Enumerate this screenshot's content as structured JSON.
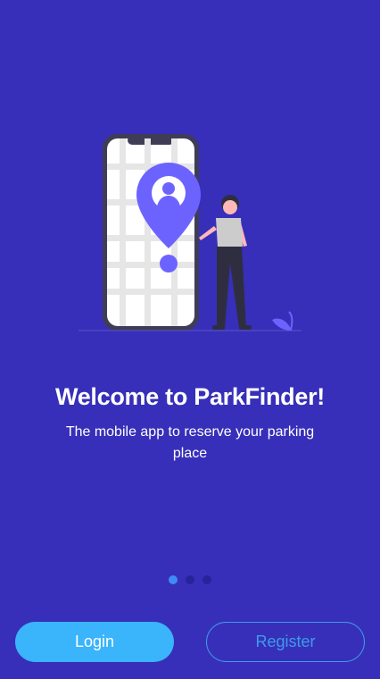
{
  "onboarding": {
    "title": "Welcome to ParkFinder!",
    "subtitle": "The mobile app to reserve your parking place",
    "pagination": {
      "total": 3,
      "active_index": 0
    },
    "illustration_icon": "phone-map-pin-person-illustration"
  },
  "actions": {
    "login_label": "Login",
    "register_label": "Register"
  },
  "colors": {
    "background": "#372fb9",
    "login_button": "#3ab4fb",
    "register_outline": "#3f9be8",
    "dot_active": "#3d8bf5",
    "dot_inactive": "#27249a",
    "pin": "#6c63ff"
  }
}
